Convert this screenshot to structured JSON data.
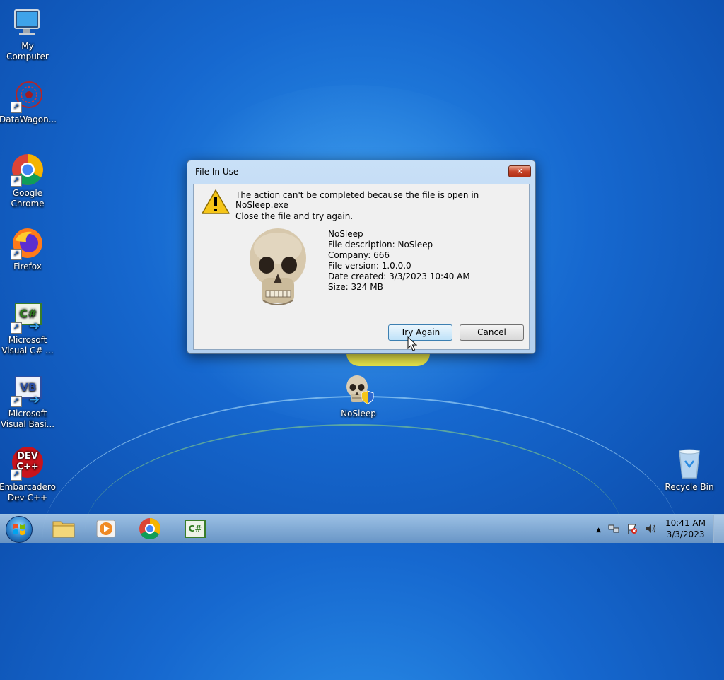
{
  "desktop": {
    "icons": [
      {
        "label": "My Computer"
      },
      {
        "label": "DataWagon..."
      },
      {
        "label": "Google Chrome"
      },
      {
        "label": "Firefox"
      },
      {
        "label": "Microsoft Visual C# ..."
      },
      {
        "label": "Microsoft Visual Basi..."
      },
      {
        "label": "Embarcadero Dev-C++"
      },
      {
        "label": "NoSleep"
      },
      {
        "label": "Recycle Bin"
      }
    ],
    "csharp_badge": "C#",
    "vb_badge": "VB",
    "devcpp_badge_top": "DEV",
    "devcpp_badge_bottom": "C++"
  },
  "dialog": {
    "title": "File In Use",
    "close_glyph": "✕",
    "message": "The action can't be completed because the file is open in NoSleep.exe",
    "instruction": "Close the file and try again.",
    "file_info": {
      "name": "NoSleep",
      "description": "File description: NoSleep",
      "company": "Company: 666",
      "version": "File version: 1.0.0.0",
      "date_created": "Date created: 3/3/2023 10:40 AM",
      "size": "Size: 324 MB"
    },
    "buttons": {
      "try_again": "Try Again",
      "cancel": "Cancel"
    }
  },
  "taskbar": {
    "pinned": [
      "file-explorer",
      "media-player",
      "google-chrome",
      "visual-csharp"
    ],
    "csharp_badge": "C#",
    "clock": {
      "time": "10:41 AM",
      "date": "3/3/2023"
    }
  }
}
